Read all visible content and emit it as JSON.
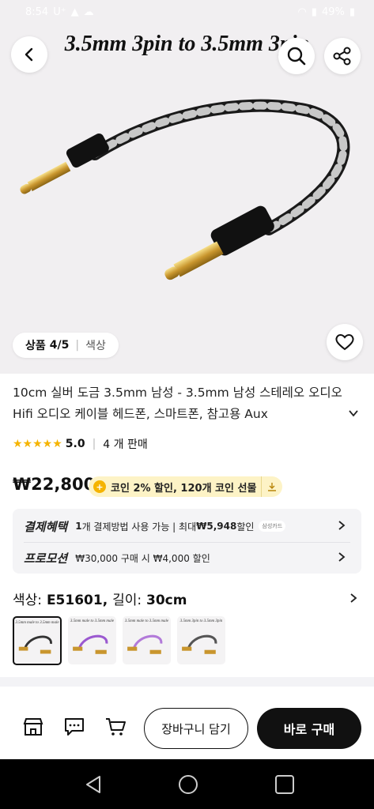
{
  "status": {
    "time": "8:54",
    "battery": "49%"
  },
  "hero": {
    "image_title": "3.5mm 3pin to 3.5mm 3pin",
    "counter_label": "상품",
    "counter_value": "4/5",
    "color_label": "색상"
  },
  "product": {
    "title": "10cm 실버 도금 3.5mm 남성 - 3.5mm 남성 스테레오 오디오 Hifi 오디오 케이블 헤드폰, 스마트폰, 참고용 Aux",
    "rating": "5.0",
    "stars": "★★★★★",
    "sold": "4 개 판매",
    "price": "₩22,800",
    "coin_text": "코인 2% 할인, 120개 코인 선물"
  },
  "promo": {
    "payment_label": "결제혜택",
    "payment_count": "1",
    "payment_text": "개 결제방법 사용 가능 | 최대 ",
    "payment_amount": "₩5,948",
    "payment_suffix": " 할인",
    "payment_card": "삼성카드",
    "promotion_label": "프로모션",
    "promotion_text": "₩30,000 구매 시 ₩4,000 할인"
  },
  "option": {
    "color_label": "색상:",
    "color_value": "E51601,",
    "length_label": "길이:",
    "length_value": "30cm",
    "thumbs": [
      "3.5mm male to 3.5mm male",
      "3.5mm male to 3.5mm male",
      "3.5mm male to 3.5mm male",
      "3.5mm 3pin to 3.5mm 3pin"
    ]
  },
  "bottom": {
    "add_to_cart": "장바구니 담기",
    "buy_now": "바로 구매"
  },
  "colors": {
    "accent": "#111111",
    "star": "#f5b400",
    "coin_bg": "#fdf3c6"
  }
}
